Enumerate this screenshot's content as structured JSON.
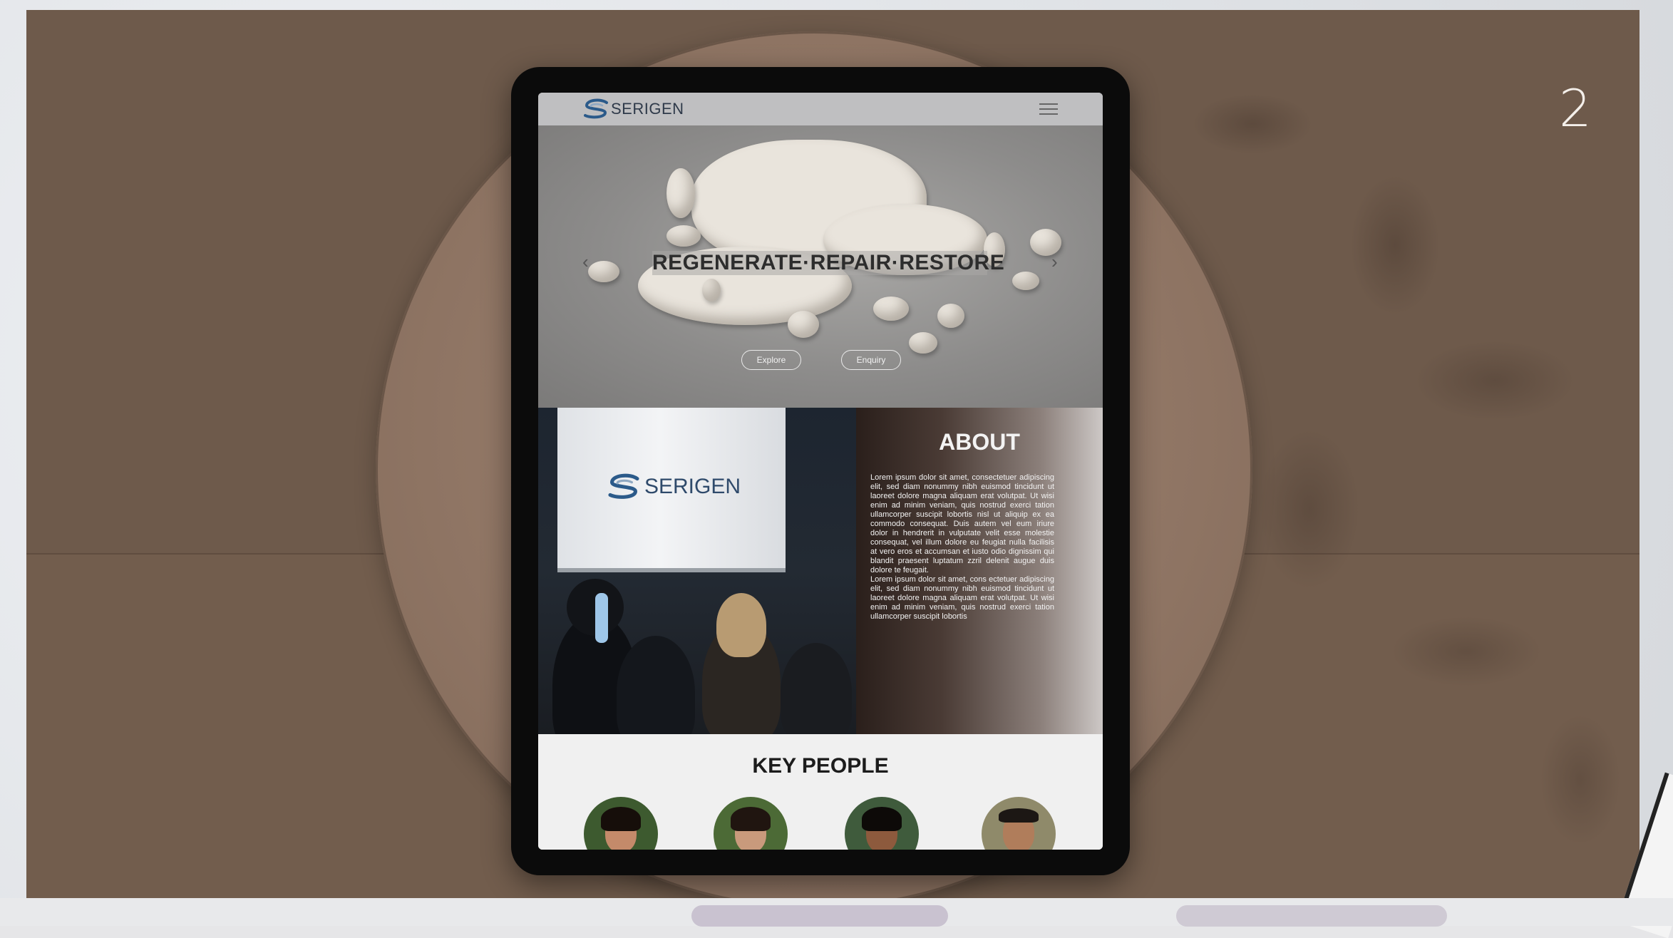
{
  "slide": {
    "number": "2"
  },
  "site": {
    "brand": "SERIGEN",
    "hero": {
      "headline": "REGENERATE·REPAIR·RESTORE",
      "buttons": [
        "Explore",
        "Enquiry"
      ]
    },
    "about": {
      "title": "ABOUT",
      "projector_brand": "SERIGEN",
      "paragraph1": "Lorem ipsum dolor sit amet, consectetuer adipiscing elit, sed diam nonummy nibh euismod tincidunt ut laoreet dolore magna aliquam erat volutpat. Ut wisi enim ad minim veniam, quis nostrud exerci tation ullamcorper suscipit lobortis nisl ut aliquip ex ea commodo consequat. Duis autem vel eum iriure dolor in hendrerit in vulputate velit esse molestie consequat, vel illum dolore eu feugiat nulla facilisis at vero eros et accumsan et iusto odio dignissim qui blandit praesent luptatum zzril delenit augue duis dolore te feugait.",
      "paragraph2": "Lorem ipsum dolor sit amet, cons ectetuer adipiscing elit, sed diam nonummy nibh euismod tincidunt ut laoreet dolore magna aliquam erat volutpat. Ut wisi enim ad minim veniam, quis nostrud exerci tation ullamcorper suscipit lobortis"
    },
    "key_people": {
      "title": "KEY PEOPLE"
    }
  }
}
